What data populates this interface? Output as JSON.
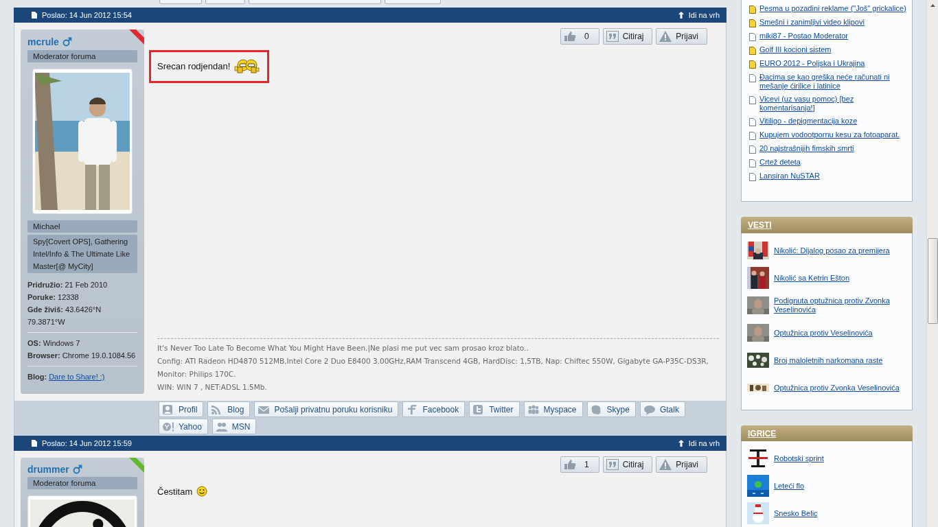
{
  "posts": [
    {
      "posted": "Poslao: 14 Jun 2012 15:54",
      "top_link": "Idi na vrh",
      "author": {
        "name": "mcrule",
        "rank": "Moderator foruma",
        "color": "#e02a33",
        "real_name": "Michael",
        "user_title": "Spy[Covert OPS], Gathering Intel/Info & The Ultimate Like Master[@ MyCity]",
        "detail_groups": [
          {
            "items": [
              {
                "kind": "text",
                "label": "Pridružio:",
                "value": "21 Feb 2010"
              },
              {
                "kind": "text",
                "label": "Poruke:",
                "value": "12338"
              },
              {
                "kind": "text",
                "label": "Gde živiš:",
                "value": "43.6426°N 79.3871°W"
              }
            ]
          },
          {
            "items": [
              {
                "kind": "text",
                "label": "OS:",
                "value": "Windows 7"
              },
              {
                "kind": "text",
                "label": "Browser:",
                "value": "Chrome 19.0.1084.56"
              }
            ]
          },
          {
            "items": [
              {
                "kind": "link",
                "label": "Blog:",
                "value": "Dare to Share! :)"
              }
            ]
          }
        ]
      },
      "likes": "0",
      "actions": [
        "Citiraj",
        "Prijavi"
      ],
      "message": "Srecan rodjendan!",
      "highlighted": true,
      "signature": [
        "It's Never Too Late To Become What You Might Have Been.|Ne plasi me put vec sam prosao kroz blato..",
        "Config: ATI Radeon HD4870 512MB,Intel Core 2 Duo E8400 3.00GHz,RAM Transcend 4GB, HardDisc: 1,5TB, Nap: Chiftec 550W, Gigabyte GA-P35C-DS3R, Monitor: Philips 170C.",
        "WIN: WIN 7 , NET:ADSL 1.5Mb."
      ],
      "contacts": [
        {
          "kind": "profile",
          "label": "Profil"
        },
        {
          "kind": "blog",
          "label": "Blog"
        },
        {
          "kind": "message",
          "label": "Pošalji privatnu poruku korisniku"
        },
        {
          "kind": "facebook",
          "label": "Facebook"
        },
        {
          "kind": "twitter",
          "label": "Twitter"
        },
        {
          "kind": "myspace",
          "label": "Myspace"
        },
        {
          "kind": "skype",
          "label": "Skype"
        },
        {
          "kind": "gtalk",
          "label": "Gtalk"
        },
        {
          "kind": "yahoo",
          "label": "Yahoo"
        },
        {
          "kind": "msn",
          "label": "MSN"
        }
      ]
    },
    {
      "posted": "Poslao: 14 Jun 2012 15:59",
      "top_link": "Idi na vrh",
      "author": {
        "name": "drummer",
        "rank": "Moderator foruma",
        "color": "#62b82a"
      },
      "likes": "1",
      "actions": [
        "Citiraj",
        "Prijavi"
      ],
      "message": "Čestitam"
    }
  ],
  "sidebar": {
    "topics": [
      {
        "title": "Pesma u pozadini reklame (\"Još\" grickalice)",
        "unread": true
      },
      {
        "title": "Smešni i zanimljivi video klipovi",
        "unread": true
      },
      {
        "title": "miki87 - Postao Moderator",
        "unread": false
      },
      {
        "title": "Golf III kocioni sistem",
        "unread": true
      },
      {
        "title": "EURO 2012 - Poljska i Ukrajina",
        "unread": true
      },
      {
        "title": "Đacima se kao greška neće računati ni mešanje ćirilice i latinice",
        "unread": false
      },
      {
        "title": "Vicevi (uz vasu pomoc) [bez komentarisanja!]",
        "unread": false
      },
      {
        "title": "Vitiligo - depigmentacija koze",
        "unread": false
      },
      {
        "title": "Kupujem vodootpornu kesu za fotoaparat.",
        "unread": false
      },
      {
        "title": "20 najstrašnijih fimskih smrti",
        "unread": false
      },
      {
        "title": "Crtež deteta",
        "unread": false
      },
      {
        "title": "Lansiran NuSTAR",
        "unread": false
      }
    ],
    "news": {
      "title": "VESTI",
      "items": [
        {
          "title": "Nikolić: Dijalog posao za premijera"
        },
        {
          "title": "Nikolić sa Ketrin Ešton"
        },
        {
          "title": "Podignuta optužnica protiv Zvonka Veselinovića"
        },
        {
          "title": "Optužnica protiv Veselinovića"
        },
        {
          "title": "Broj maloletnih narkomana raste"
        },
        {
          "title": "Optužnica protiv Zvonka Veselinovića"
        }
      ]
    },
    "games": {
      "title": "IGRICE",
      "items": [
        {
          "title": "Robotski sprint"
        },
        {
          "title": "Leteći flo"
        },
        {
          "title": "Snesko Belic"
        }
      ]
    }
  }
}
